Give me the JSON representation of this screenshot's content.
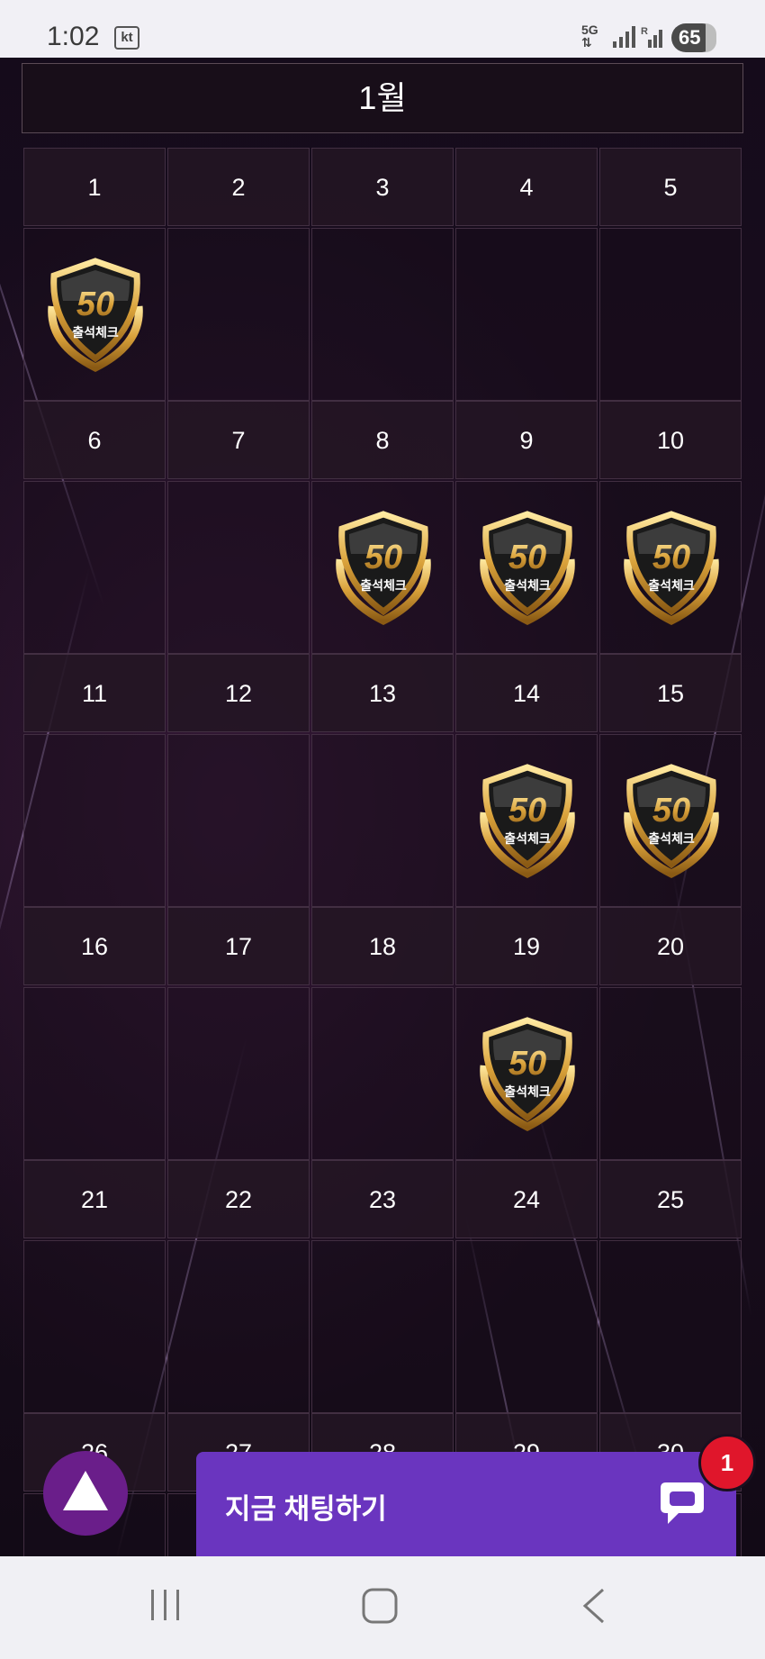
{
  "status_bar": {
    "time": "1:02",
    "carrier": "kt",
    "network": "5G",
    "battery": "65"
  },
  "calendar": {
    "month_title": "1월",
    "badge_number": "50",
    "badge_text": "출석체크",
    "weeks": [
      {
        "days": [
          "1",
          "2",
          "3",
          "4",
          "5"
        ],
        "checked": [
          true,
          false,
          false,
          false,
          false
        ]
      },
      {
        "days": [
          "6",
          "7",
          "8",
          "9",
          "10"
        ],
        "checked": [
          false,
          false,
          true,
          true,
          true
        ]
      },
      {
        "days": [
          "11",
          "12",
          "13",
          "14",
          "15"
        ],
        "checked": [
          false,
          false,
          false,
          true,
          true
        ]
      },
      {
        "days": [
          "16",
          "17",
          "18",
          "19",
          "20"
        ],
        "checked": [
          false,
          false,
          false,
          true,
          false
        ]
      },
      {
        "days": [
          "21",
          "22",
          "23",
          "24",
          "25"
        ],
        "checked": [
          false,
          false,
          false,
          false,
          false
        ]
      },
      {
        "days": [
          "26",
          "27",
          "28",
          "29",
          "30"
        ],
        "checked": [
          false,
          false,
          false,
          false,
          false
        ]
      }
    ]
  },
  "chat": {
    "label": "지금 채팅하기",
    "unread_count": "1"
  },
  "colors": {
    "chat_bar": "#6a35bf",
    "scroll_top_button": "#6a1e8a",
    "unread_badge": "#e0162b"
  },
  "icons": [
    "scroll-top-icon",
    "chat-bubble-icon",
    "recent-apps-icon",
    "home-icon",
    "back-icon"
  ]
}
